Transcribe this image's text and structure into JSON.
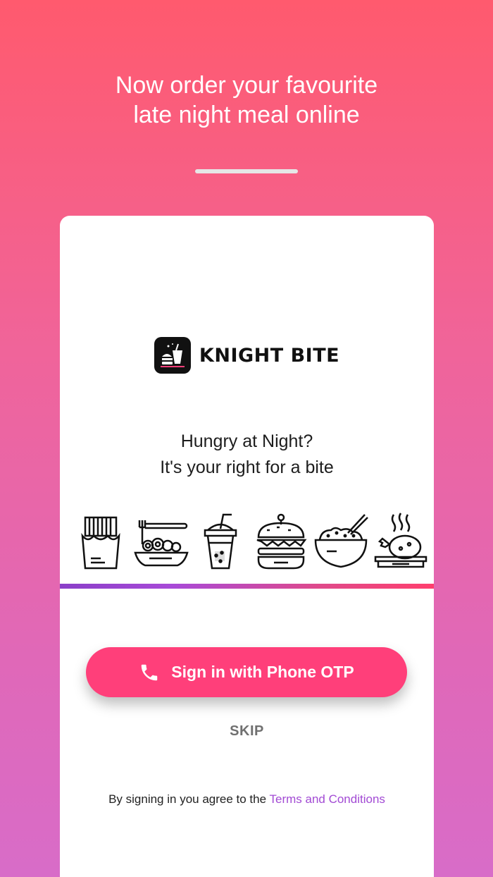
{
  "header": {
    "line1": "Now order your favourite",
    "line2": "late night meal online"
  },
  "brand": {
    "name": "KNIGHT BITE",
    "logo_icon": "fast-food-icon"
  },
  "tagline": {
    "line1": "Hungry at Night?",
    "line2": "It's your right for a bite"
  },
  "food_icons": [
    "fries-icon",
    "noodles-icon",
    "drink-icon",
    "burger-icon",
    "rice-bowl-icon",
    "roast-chicken-icon"
  ],
  "signin": {
    "label": "Sign in with Phone OTP",
    "icon": "phone-icon"
  },
  "skip_label": "SKIP",
  "terms": {
    "prefix": "By signing in you agree to the ",
    "link": "Terms and Conditions"
  },
  "colors": {
    "gradient_top": "#ff5a6e",
    "gradient_bottom": "#d86cc8",
    "button": "#ff3f7a",
    "link": "#a24ad4"
  }
}
